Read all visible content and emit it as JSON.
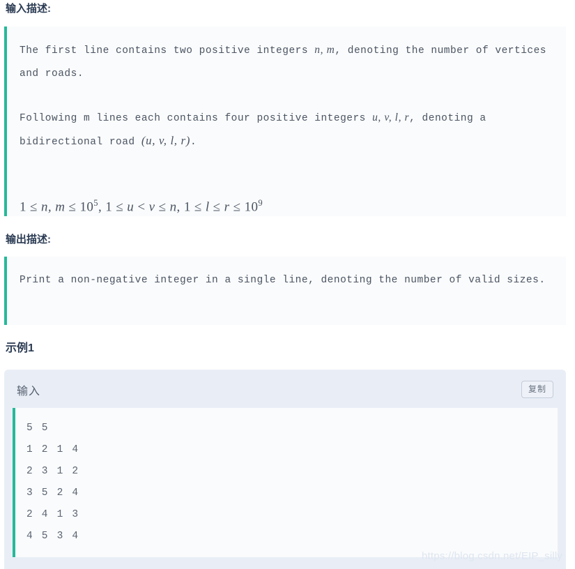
{
  "input_section": {
    "heading": "输入描述:",
    "paragraphs": [
      {
        "pre": "The first line contains two positive integers ",
        "math": "n, m",
        "post": ", denoting the number of vertices and roads."
      },
      {
        "pre": "Following m lines each contains four positive integers ",
        "math": "u, v, l, r",
        "post": ", denoting a bidirectional road ",
        "math2": "(u, v, l, r)",
        "post2": "."
      }
    ],
    "constraint": "1 ≤ n, m ≤ 10^5, 1 ≤ u < v ≤ n, 1 ≤ l ≤ r ≤ 10^9",
    "constraint_parts": {
      "p1": "1 ≤ ",
      "v1": "n, m",
      "p2": " ≤ 10",
      "e1": "5",
      "p3": ", 1 ≤ ",
      "v2": "u",
      "p4": " < ",
      "v3": "v",
      "p5": " ≤ ",
      "v4": "n",
      "p6": ", 1 ≤ ",
      "v5": "l",
      "p7": " ≤ ",
      "v6": "r",
      "p8": " ≤ 10",
      "e2": "9"
    }
  },
  "output_section": {
    "heading": "输出描述:",
    "text": "Print a non-negative integer in a single line, denoting the number of valid sizes."
  },
  "example_section": {
    "heading": "示例1",
    "panel_label": "输入",
    "copy_label": "复制",
    "code_lines": [
      "5 5",
      "1 2 1 4",
      "2 3 1 2",
      "3 5 2 4",
      "2 4 1 3",
      "4 5 3 4"
    ]
  },
  "watermark": {
    "text": "https://blog.csdn.net/EIP_silly"
  },
  "colors": {
    "accent": "#26b99a",
    "heading": "#2b3b53",
    "panel_bg": "#fafbfc",
    "example_bg": "#e9eef6",
    "body_text": "#4a5462",
    "watermark": "#dfe6f0"
  }
}
